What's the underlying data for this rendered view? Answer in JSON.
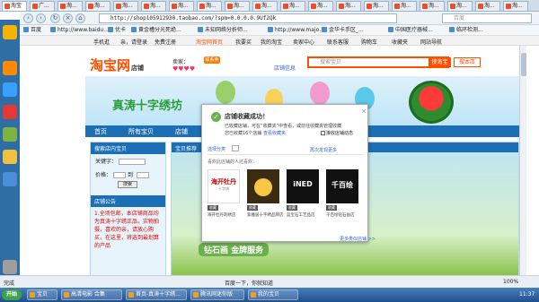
{
  "browser": {
    "tabs": [
      {
        "label": "淘宝"
      },
      {
        "label": "广..."
      },
      {
        "label": "淘..."
      },
      {
        "label": "淘..."
      },
      {
        "label": "淘..."
      },
      {
        "label": "淘..."
      },
      {
        "label": "淘..."
      },
      {
        "label": "淘..."
      },
      {
        "label": "淘..."
      },
      {
        "label": "淘..."
      },
      {
        "label": "淘..."
      },
      {
        "label": "淘..."
      },
      {
        "label": "淘..."
      },
      {
        "label": "淘..."
      },
      {
        "label": "淘..."
      },
      {
        "label": "淘..."
      },
      {
        "label": "淘..."
      },
      {
        "label": "淘..."
      },
      {
        "label": "淘..."
      }
    ],
    "url": "http://shop105912930.taobao.com/?spm=0.0.0.0.9Uf2Qk",
    "search_placeholder": "百度",
    "bookmarks": [
      {
        "label": "百度"
      },
      {
        "label": "http://www.baidu..."
      },
      {
        "label": "优卡"
      },
      {
        "label": "黄金槽分光死绝..."
      },
      {
        "label": "未知网络分析师..."
      },
      {
        "label": "http://www.majo..."
      },
      {
        "label": "金华卡手区_..."
      },
      {
        "label": "中国医疗器械..."
      },
      {
        "label": "临环检测..."
      }
    ],
    "site_nav": [
      {
        "label": "手机逛"
      },
      {
        "label": "亲，请登录"
      },
      {
        "label": "免费注册"
      },
      {
        "label": "淘宝网首页"
      },
      {
        "label": "我要买"
      },
      {
        "label": "我的淘宝"
      },
      {
        "label": "卖家中心"
      },
      {
        "label": "联系客服"
      },
      {
        "label": "购物车"
      },
      {
        "label": "收藏夹"
      },
      {
        "label": "网站导航"
      }
    ]
  },
  "shop": {
    "logo": "淘宝网",
    "logo_sub": "店铺",
    "seller_label": "卖家：",
    "badge": "联系卖家",
    "hearts": "♥♥♥♥",
    "shop_info": "店铺信息",
    "search_placeholder": "搜索宝贝",
    "search_taobao": "搜淘宝",
    "search_shop": "搜本店",
    "banner_title": "真涛十字绣坊",
    "nav": [
      {
        "label": "首页"
      },
      {
        "label": "所有宝贝"
      },
      {
        "label": "店铺"
      },
      {
        "label": "店铺动态"
      }
    ],
    "sidebar": {
      "title": "搜索店内宝贝",
      "keyword_label": "关键字：",
      "price_label": "价格：",
      "price_sep": "到",
      "search_btn": "搜索",
      "notice_title": "店铺公告",
      "notice_text": "1.全场包邮，本店铺商品均为真涛十字绣正品，实物拍摄，喜欢的亲，请放心购买，在这里，将选到最划算的产品"
    },
    "main_header": "宝贝推荐",
    "main_green": "钻石画  金牌服务"
  },
  "popup": {
    "title": "店铺收藏成功！",
    "line1": "已收藏店铺，可在“收藏夹”中查看，或前往收藏夹管理收藏",
    "line1_link": "收藏夹",
    "line2": "您已收藏16个店铺",
    "line2_link": "查看收藏夹",
    "remind": "接收店铺动态",
    "category_label": "选择分类",
    "want_more": "再次发现更多",
    "also_label": "喜欢此店铺的人还喜欢：",
    "recommendations": [
      {
        "label": "海开牡丹刺绣店",
        "btn": "收藏"
      },
      {
        "label": "紫雅居十字绣品牌店",
        "btn": "收藏"
      },
      {
        "label": "蓝宝石工艺品店",
        "btn": "收藏"
      },
      {
        "label": "千百绘钻石画店",
        "btn": "收藏"
      }
    ],
    "more_link": "更多类似店铺 >>"
  },
  "status": {
    "left": "完成",
    "center": "百度一下，你就知道",
    "zoom": "100%"
  },
  "taskbar": {
    "start": "开始",
    "tasks": [
      {
        "label": "宝贝"
      },
      {
        "label": "高清电影 合集"
      },
      {
        "label": "首页-真涛十字绣..."
      },
      {
        "label": "腾讯网迷你版"
      },
      {
        "label": "我的宝贝"
      }
    ],
    "clock": "11:37"
  },
  "colors": {
    "taobao_orange": "#ff5000",
    "shop_blue": "#1d6fb5",
    "success_green": "#6ab04c"
  }
}
